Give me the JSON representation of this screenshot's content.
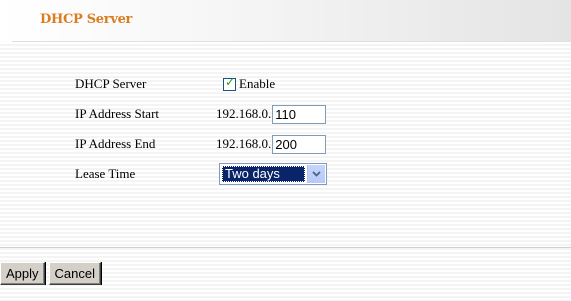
{
  "header": {
    "title": "DHCP Server"
  },
  "form": {
    "dhcp_server": {
      "label": "DHCP Server",
      "checkbox_checked": true,
      "checkbox_label": "Enable"
    },
    "ip_start": {
      "label": "IP Address Start",
      "prefix": "192.168.0.",
      "value": "110"
    },
    "ip_end": {
      "label": "IP Address End",
      "prefix": "192.168.0.",
      "value": "200"
    },
    "lease_time": {
      "label": "Lease Time",
      "selected": "Two days"
    }
  },
  "buttons": {
    "apply": "Apply",
    "cancel": "Cancel"
  },
  "colors": {
    "title": "#d97d20",
    "select_highlight": "#0a246a",
    "checkmark": "#21a121"
  },
  "icons": {
    "checkbox": "checkmark-icon",
    "dropdown": "chevron-down-icon"
  }
}
